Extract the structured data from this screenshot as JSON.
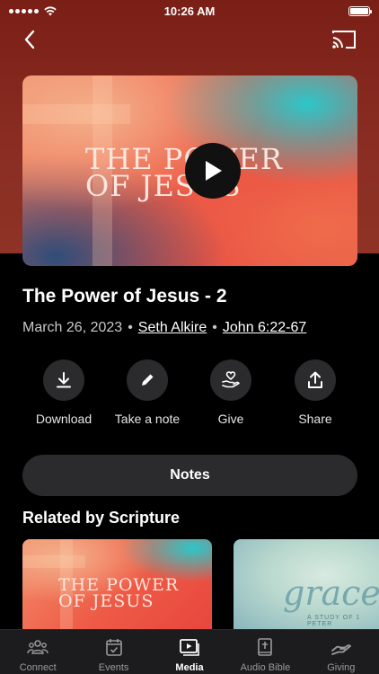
{
  "status_bar": {
    "time": "10:26 AM"
  },
  "hero": {
    "title_line1": "THE POWER",
    "title_line2": "OF JESUS"
  },
  "sermon": {
    "title": "The Power of Jesus - 2",
    "date": "March 26, 2023",
    "speaker": "Seth Alkire",
    "scripture": "John 6:22-67",
    "separator": "•"
  },
  "actions": [
    {
      "label": "Download",
      "icon": "download-icon"
    },
    {
      "label": "Take a note",
      "icon": "pencil-icon"
    },
    {
      "label": "Give",
      "icon": "give-heart-hand-icon"
    },
    {
      "label": "Share",
      "icon": "share-icon"
    }
  ],
  "notes_button": "Notes",
  "related": {
    "title": "Related by Scripture",
    "cards": [
      {
        "line1": "THE POWER",
        "line2": "OF JESUS"
      },
      {
        "word": "grace",
        "subtitle": "A STUDY OF 1 PETER"
      }
    ]
  },
  "tabs": [
    {
      "label": "Connect",
      "icon": "people-icon",
      "active": false
    },
    {
      "label": "Events",
      "icon": "calendar-icon",
      "active": false
    },
    {
      "label": "Media",
      "icon": "media-play-icon",
      "active": true
    },
    {
      "label": "Audio Bible",
      "icon": "bible-icon",
      "active": false
    },
    {
      "label": "Giving",
      "icon": "giving-hand-icon",
      "active": false
    }
  ],
  "colors": {
    "header_bg": "#8a2c22",
    "surface": "#2b2b2d",
    "tabbar": "#1c1c1e"
  }
}
